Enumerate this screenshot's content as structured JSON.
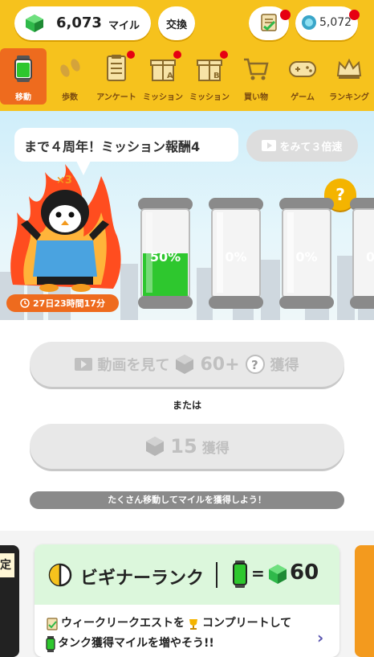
{
  "header": {
    "miles_value": "6,073",
    "miles_unit": "マイル",
    "exchange_label": "交換",
    "coins_value": "5,072"
  },
  "nav": [
    {
      "label": "移動",
      "icon": "tank-icon",
      "active": true,
      "badge": false
    },
    {
      "label": "歩数",
      "icon": "footprints-icon",
      "active": false,
      "badge": false
    },
    {
      "label": "アンケート",
      "icon": "survey-icon",
      "active": false,
      "badge": true
    },
    {
      "label": "ミッション",
      "icon": "gift-a-icon",
      "active": false,
      "badge": true
    },
    {
      "label": "ミッション",
      "icon": "gift-b-icon",
      "active": false,
      "badge": true
    },
    {
      "label": "買い物",
      "icon": "cart-icon",
      "active": false,
      "badge": false
    },
    {
      "label": "ゲーム",
      "icon": "gamepad-icon",
      "active": false,
      "badge": false
    },
    {
      "label": "ランキング",
      "icon": "crown-icon",
      "active": false,
      "badge": false
    }
  ],
  "hero": {
    "speech": "まで４周年！ミッション報酬4",
    "video_label": "をみて３倍速",
    "help_label": "?",
    "multiplier": "×3",
    "timer": "27日23時間17分",
    "tanks": [
      {
        "label": "50%",
        "fill": 0.5
      },
      {
        "label": "0%",
        "fill": 0
      },
      {
        "label": "0%",
        "fill": 0
      },
      {
        "label": "0",
        "fill": 0
      }
    ]
  },
  "actions": {
    "video_button_text": "動画を見て",
    "video_button_amount": "60+",
    "video_button_suffix": "獲得",
    "or_text": "または",
    "get_button_amount": "15",
    "get_button_suffix": "獲得",
    "info_text": "たくさん移動してマイルを獲得しよう！"
  },
  "cards": {
    "left_tag": "定",
    "rank_title": "ビギナーランク",
    "rank_eq": "=",
    "rank_value": "60",
    "line1_a": "ウィークリークエストを",
    "line1_b": "コンプリートして",
    "line2_a": "タンク獲得マイルを増やそう!!"
  },
  "colors": {
    "header_bg": "#f6c21d",
    "nav_active": "#ee6b1e",
    "badge_red": "#e60012",
    "tank_green": "#2ec72e",
    "rank_bg": "#dcf7dc"
  }
}
